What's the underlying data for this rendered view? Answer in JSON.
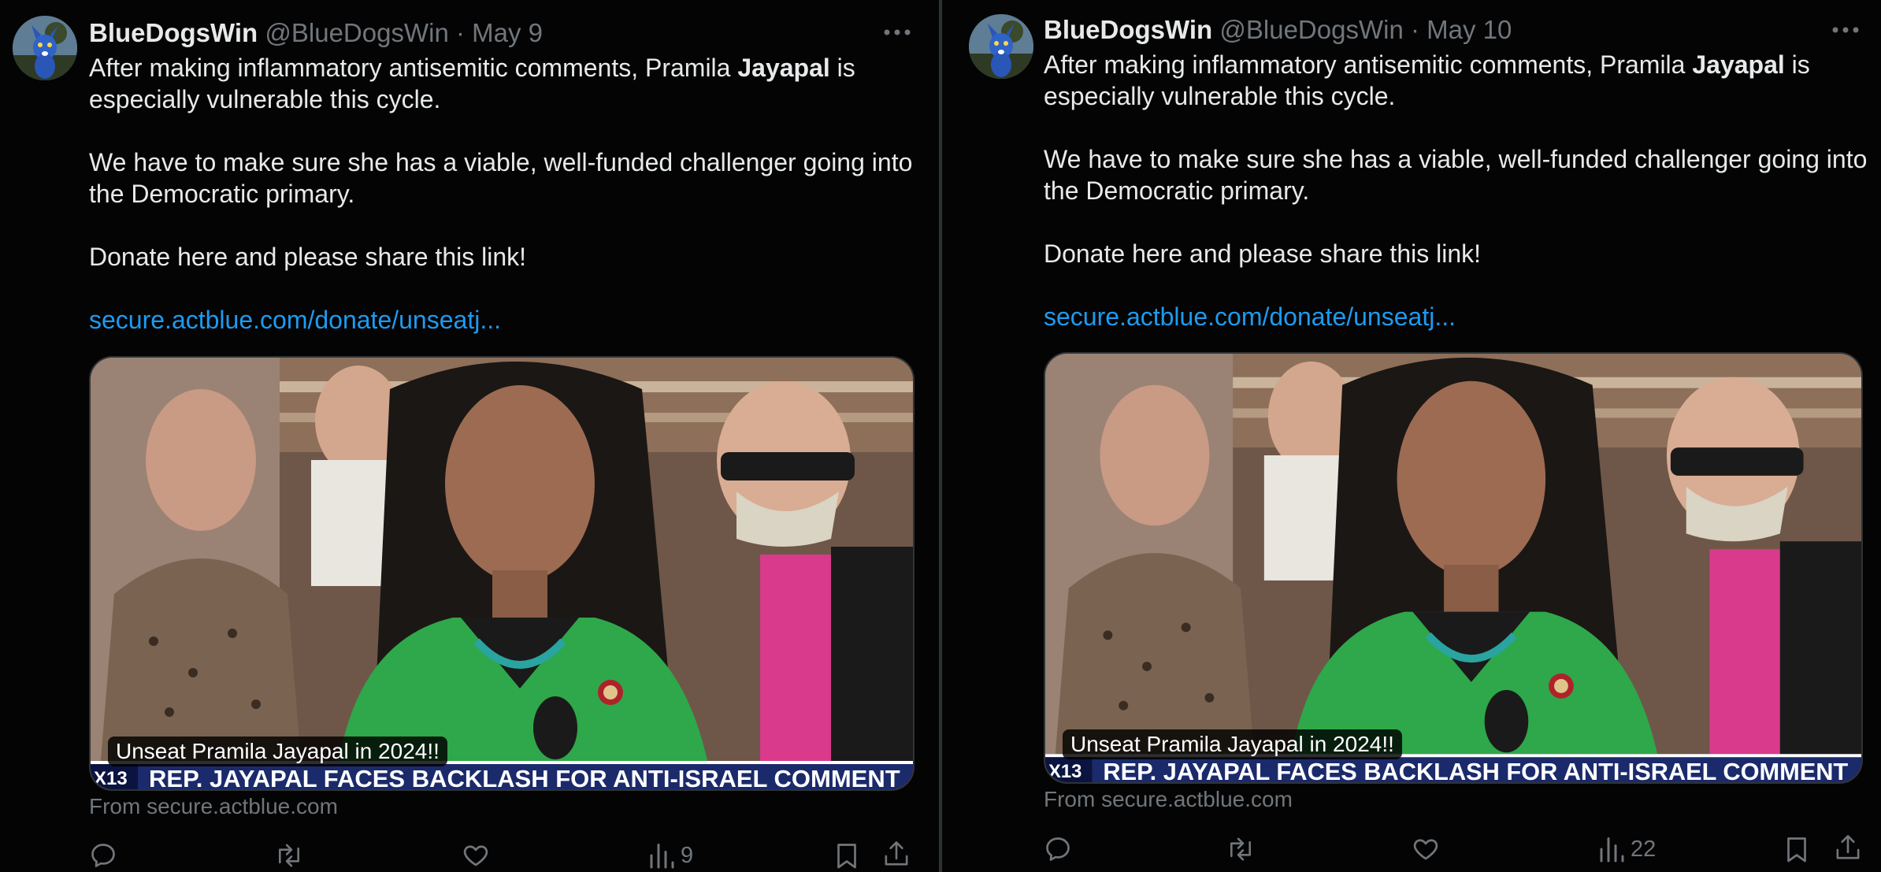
{
  "tweets": [
    {
      "author_name": "BlueDogsWin",
      "handle": "@BlueDogsWin",
      "separator": "·",
      "date": "May 9",
      "text": {
        "line1_before": "After making inflammatory antisemitic comments, Pramila ",
        "line1_bold": "Jayapal",
        "line1_after": " is",
        "line2": "especially vulnerable this cycle.",
        "line3": "We have to make sure she has a viable, well-funded challenger going into",
        "line4": "the Democratic primary.",
        "line5": "Donate here and please share this link!",
        "link": "secure.actblue.com/donate/unseatj..."
      },
      "media": {
        "caption": "Unseat Pramila Jayapal in 2024!!",
        "chyron_badge": "X13",
        "chyron_text": "REP. JAYAPAL FACES BACKLASH FOR ANTI-ISRAEL COMMENT"
      },
      "source": "From secure.actblue.com",
      "views_count": "9",
      "icons": {
        "reply": "reply-icon",
        "repost": "repost-icon",
        "like": "like-icon",
        "views": "views-icon",
        "bookmark": "bookmark-icon",
        "share": "share-icon",
        "more": "more-icon"
      }
    },
    {
      "author_name": "BlueDogsWin",
      "handle": "@BlueDogsWin",
      "separator": "·",
      "date": "May 10",
      "text": {
        "line1_before": "After making inflammatory antisemitic comments, Pramila ",
        "line1_bold": "Jayapal",
        "line1_after": " is",
        "line2": "especially vulnerable this cycle.",
        "line3": "We have to make sure she has a viable, well-funded challenger going into",
        "line4": "the Democratic primary.",
        "line5": "Donate here and please share this link!",
        "link": "secure.actblue.com/donate/unseatj..."
      },
      "media": {
        "caption": "Unseat Pramila Jayapal in 2024!!",
        "chyron_badge": "X13",
        "chyron_text": "REP. JAYAPAL FACES BACKLASH FOR ANTI-ISRAEL COMMENT"
      },
      "source": "From secure.actblue.com",
      "views_count": "22",
      "icons": {
        "reply": "reply-icon",
        "repost": "repost-icon",
        "like": "like-icon",
        "views": "views-icon",
        "bookmark": "bookmark-icon",
        "share": "share-icon",
        "more": "more-icon"
      }
    }
  ],
  "colors": {
    "background": "#000000",
    "text": "#e7e9ea",
    "secondary_text": "#71767b",
    "link": "#1d9bf0",
    "border": "#2f3336",
    "jacket_green": "#2ea84a",
    "chyron_navy": "#1b2a6b"
  }
}
